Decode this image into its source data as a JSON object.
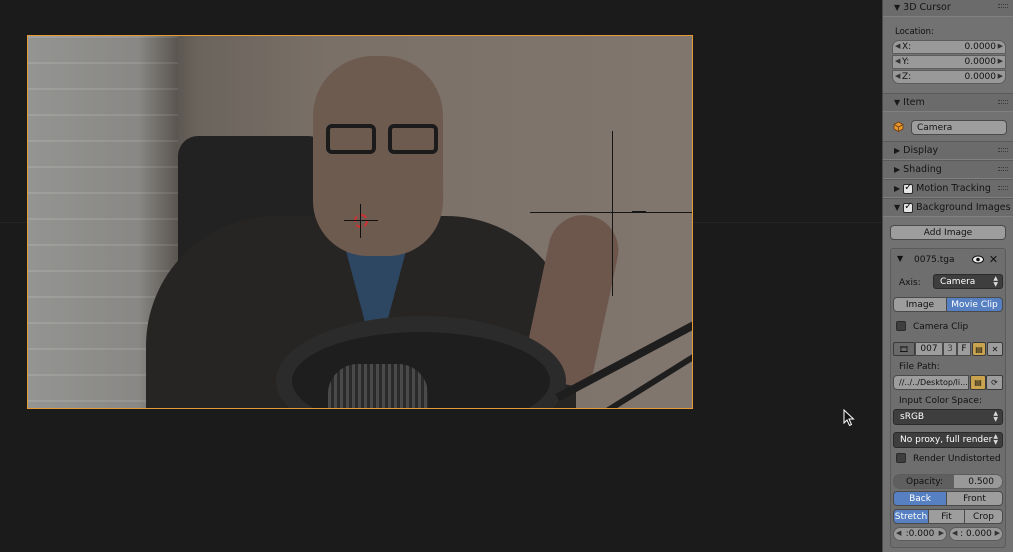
{
  "panel": {
    "cursor3d": {
      "header": "3D Cursor",
      "location_label": "Location:",
      "x_label": "X:",
      "x_value": "0.0000",
      "y_label": "Y:",
      "y_value": "0.0000",
      "z_label": "Z:",
      "z_value": "0.0000"
    },
    "item": {
      "header": "Item",
      "name_value": "Camera"
    },
    "display": {
      "header": "Display"
    },
    "shading": {
      "header": "Shading"
    },
    "motion_tracking": {
      "header": "Motion Tracking"
    },
    "background_images": {
      "header": "Background Images",
      "add_image_label": "Add Image",
      "image_name": "0075.tga",
      "axis_label": "Axis:",
      "axis_value": "Camera",
      "source_image_label": "Image",
      "source_movieclip_label": "Movie Clip",
      "camera_clip_label": "Camera Clip",
      "clip_number": "007",
      "clip_users": "3",
      "fake_user_label": "F",
      "file_path_label": "File Path:",
      "file_path_value": "//../../Desktop/li...",
      "color_space_label": "Input Color Space:",
      "color_space_value": "sRGB",
      "proxy_value": "No proxy, full render",
      "render_undistorted_label": "Render Undistorted",
      "opacity_label": "Opacity:",
      "opacity_value": "0.500",
      "back_label": "Back",
      "front_label": "Front",
      "stretch_label": "Stretch",
      "fit_label": "Fit",
      "crop_label": "Crop",
      "offset_x_value": ":0.000",
      "offset_y_value": ": 0.000"
    }
  },
  "colors": {
    "frame_border": "#e49a35",
    "active_button": "#5680c2",
    "panel_bg": "#727272",
    "viewport_bg": "#1b1b1b"
  }
}
